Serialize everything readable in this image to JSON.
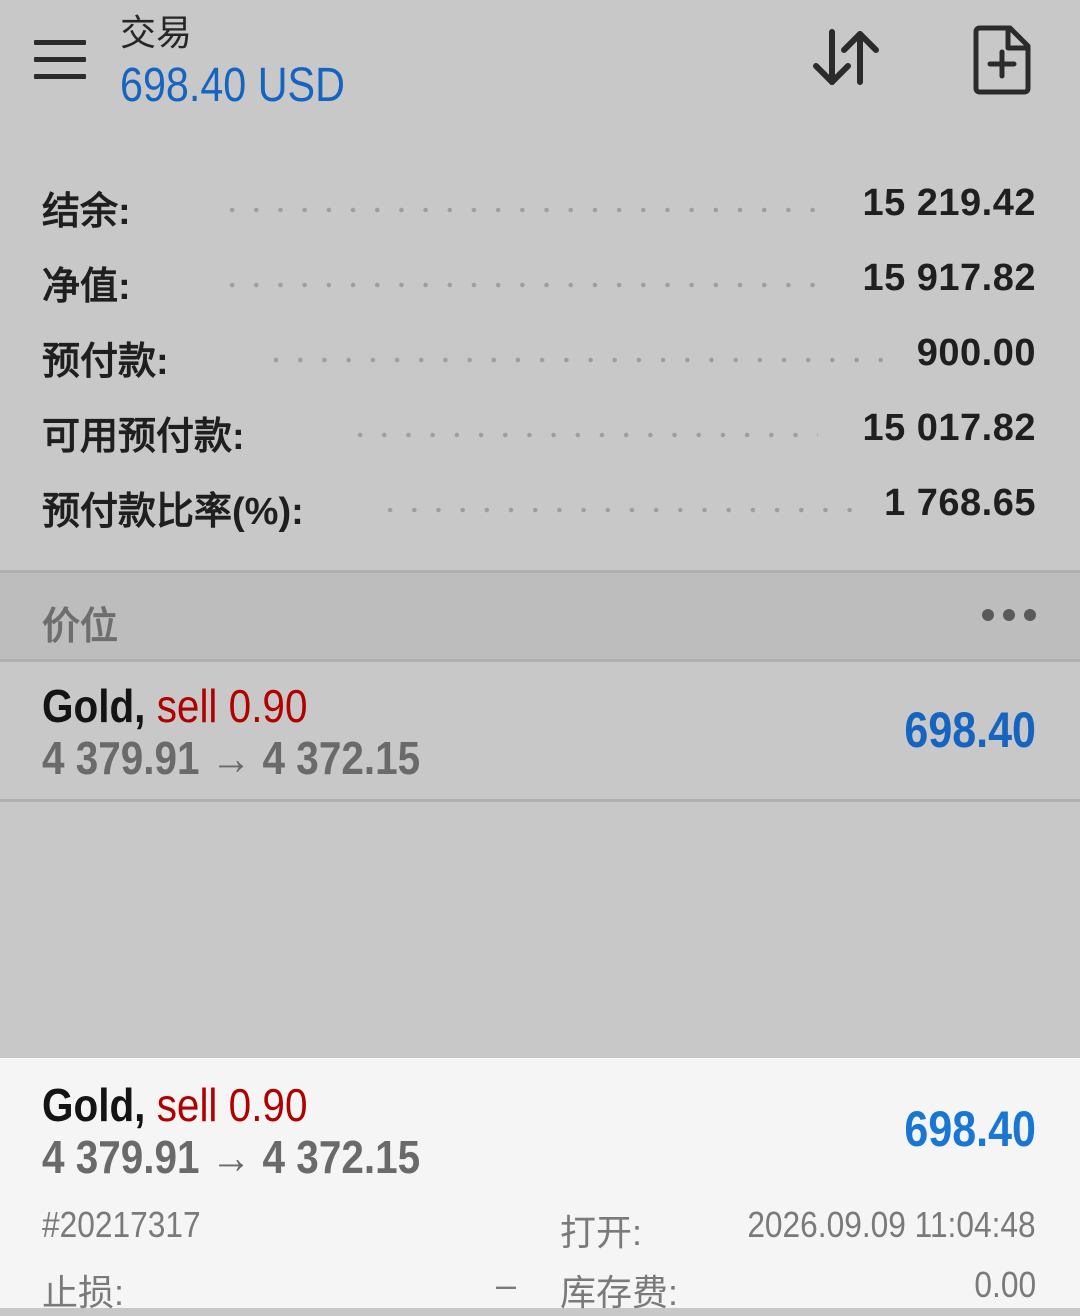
{
  "header": {
    "title": "交易",
    "subtitle": "698.40 USD"
  },
  "summary": [
    {
      "label": "结余:",
      "value": "15 219.42"
    },
    {
      "label": "净值:",
      "value": "15 917.82"
    },
    {
      "label": "预付款:",
      "value": "900.00"
    },
    {
      "label": "可用预付款:",
      "value": "15 017.82"
    },
    {
      "label": "预付款比率(%):",
      "value": "1 768.65"
    }
  ],
  "positions_section": {
    "title": "价位"
  },
  "position": {
    "symbol": "Gold,",
    "side": "sell 0.90",
    "prices": "4 379.91 → 4 372.15",
    "profit": "698.40"
  },
  "details": {
    "symbol": "Gold,",
    "side": "sell 0.90",
    "prices": "4 379.91 → 4 372.15",
    "profit": "698.40",
    "ticket": "#20217317",
    "open_label": "打开:",
    "open_value": "2026.09.09 11:04:48",
    "sl_label": "止损:",
    "sl_value": "–",
    "swap_label": "库存费:",
    "swap_value": "0.00"
  },
  "colors": {
    "accent": "#1565c0",
    "sell": "#b00000",
    "background": "#c8c8c8",
    "sheet": "#f5f5f5"
  }
}
